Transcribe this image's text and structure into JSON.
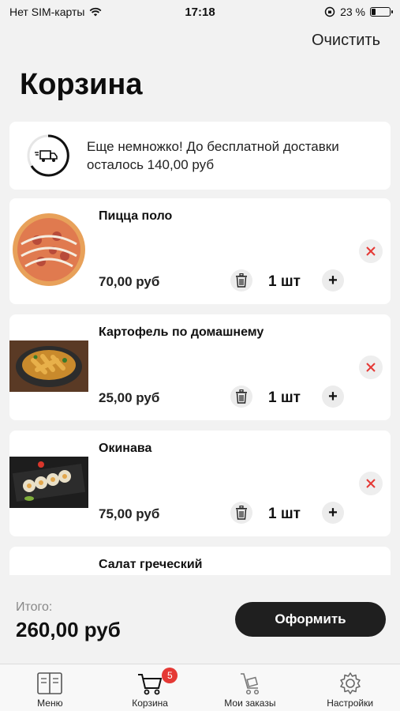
{
  "status_bar": {
    "carrier": "Нет SIM-карты",
    "time": "17:18",
    "battery": "23 %"
  },
  "header": {
    "clear_label": "Очистить",
    "title": "Корзина"
  },
  "delivery": {
    "line1": "Еще немножко! До бесплатной доставки",
    "line2": "осталось 140,00 руб",
    "progress_fraction": 0.65
  },
  "items": [
    {
      "name": "Пицца поло",
      "price": "70,00 руб",
      "qty": "1 шт",
      "image": "pizza"
    },
    {
      "name": "Картофель по домашнему",
      "price": "25,00 руб",
      "qty": "1 шт",
      "image": "potatoes"
    },
    {
      "name": "Окинава",
      "price": "75,00 руб",
      "qty": "1 шт",
      "image": "sushi"
    },
    {
      "name": "Салат греческий",
      "price": "",
      "qty": "",
      "image": "salad"
    }
  ],
  "total": {
    "label": "Итого:",
    "value": "260,00 руб",
    "checkout_label": "Оформить"
  },
  "tabs": [
    {
      "label": "Меню",
      "icon": "menu-book-icon"
    },
    {
      "label": "Корзина",
      "icon": "cart-icon",
      "badge": "5"
    },
    {
      "label": "Мои заказы",
      "icon": "orders-cart-icon"
    },
    {
      "label": "Настройки",
      "icon": "gear-icon"
    }
  ],
  "colors": {
    "accent_dark": "#1f1f1f",
    "badge_red": "#e53935",
    "remove_red": "#e53935"
  }
}
